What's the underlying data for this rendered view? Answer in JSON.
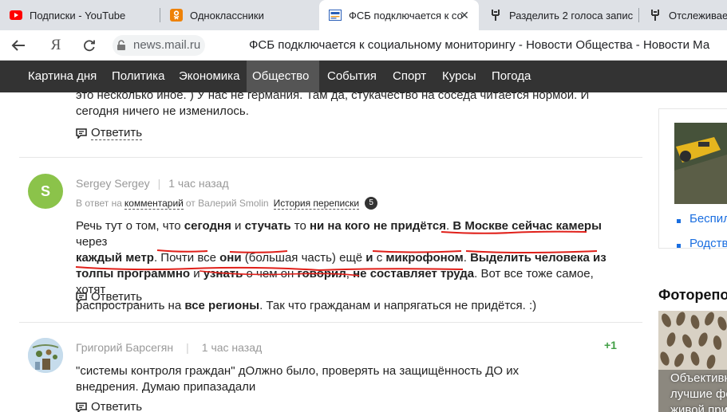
{
  "browser": {
    "tabs": [
      {
        "title": "Подписки - YouTube",
        "icon": "youtube-icon"
      },
      {
        "title": "Одноклассники",
        "icon": "odnoklassniki-icon"
      },
      {
        "title": "ФСБ подключается к со",
        "icon": "mailru-icon",
        "active": true
      },
      {
        "title": "Разделить 2 голоса запис",
        "icon": "tuning-fork-icon"
      },
      {
        "title": "Отслеживает",
        "icon": "tuning-fork-icon"
      }
    ],
    "close_glyph": "✕",
    "yandex_glyph": "Я",
    "domain": "news.mail.ru",
    "page_title": "ФСБ подключается к социальному мониторингу - Новости Общества - Новости Ма"
  },
  "site_nav": {
    "items": [
      "Картина дня",
      "Политика",
      "Экономика",
      "Общество",
      "События",
      "Спорт",
      "Курсы",
      "Погода"
    ],
    "active": "Общество"
  },
  "comments": {
    "reply_label": "Ответить",
    "top": {
      "line1": "это несколько иное. ) У нас не германия. Там да, стукачество на соседа читается нормой. И",
      "line2": "сегодня ничего не изменилось."
    },
    "c1": {
      "avatar_letter": "S",
      "author": "Sergey Sergey",
      "time": "1 час назад",
      "in_reply_prefix": "В ответ на",
      "in_reply_link": "комментарий",
      "in_reply_from": "от Валерий Smolin",
      "history_label": "История переписки",
      "history_count": "5",
      "p1": "Речь тут о том, что ",
      "b1": "сегодня",
      "p2": " и ",
      "b2": "стучать",
      "p3": " то ",
      "b3": "ни на кого не придётся",
      "p4": ". ",
      "b4": "В Москве сейчас камеры",
      "p5": " через",
      "line2_b1": "каждый метр",
      "line2_p1": ". Почти все ",
      "line2_b2": "они",
      "line2_p2": " (большая часть) ещё ",
      "line2_b3": "и",
      "line2_p3": " с ",
      "line2_b4": "микрофоном",
      "line2_p4": ". ",
      "line2_b5": "Выделить человека из",
      "line3_b1": "толпы программно",
      "line3_p1": " и ",
      "line3_b2": "узнать",
      "line3_p2": " о чем он ",
      "line3_b3": "говорил",
      "line3_p3": ", ",
      "line3_b4": "не составляет труда",
      "line3_p4": ". Вот все тоже самое, хотят",
      "line4_p1": "распространить на ",
      "line4_b1": "все регионы",
      "line4_p2": ". Так что гражданам и напрягаться не придётся. :)"
    },
    "c2": {
      "author": "Григорий Барсегян",
      "time": "1 час назад",
      "score": "+1",
      "line1": "\"системы контроля граждан\" дОлжно было, проверять на защищённость ДО их",
      "line2": "внедрения. Думаю припазадали"
    }
  },
  "sidebar": {
    "link1": "Беспил",
    "link2": "Родств",
    "heading": "Фоторепо",
    "caption1": "Объективн",
    "caption2": "лучшие фо",
    "caption3": "живой при"
  },
  "colors": {
    "nav_bg": "#333333",
    "nav_active": "#555555",
    "link_blue": "#1a6ee0",
    "red_annotation": "#e0201a",
    "score_green": "#43a047"
  }
}
